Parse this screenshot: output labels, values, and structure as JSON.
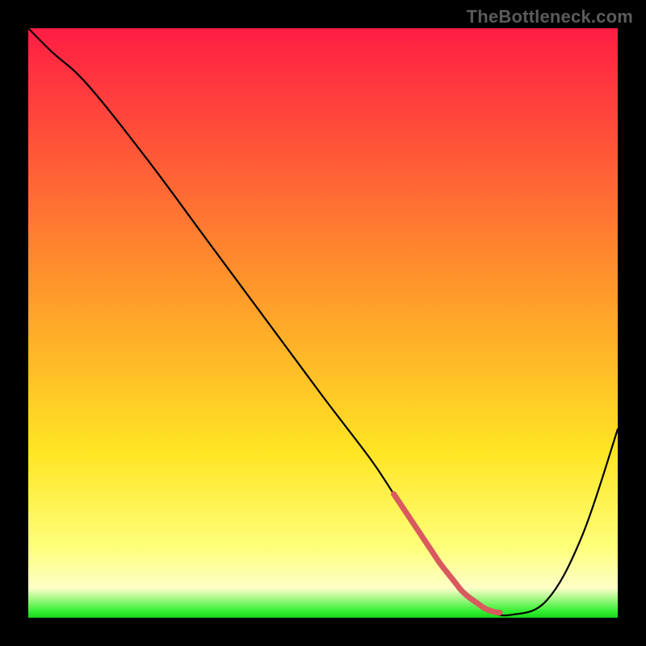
{
  "watermark": "TheBottleneck.com",
  "chart_data": {
    "type": "line",
    "title": "",
    "xlabel": "",
    "ylabel": "",
    "xlim": [
      0,
      100
    ],
    "ylim": [
      0,
      100
    ],
    "grid": false,
    "legend": false,
    "x": [
      0,
      4,
      10,
      20,
      30,
      40,
      50,
      58,
      62,
      66,
      70,
      74,
      78,
      82,
      88,
      94,
      100
    ],
    "values": [
      100,
      96,
      90.5,
      78,
      64.5,
      51,
      37.5,
      27,
      21,
      15,
      9,
      4,
      1.2,
      0.5,
      3,
      14,
      32
    ],
    "accent_segment": {
      "x_range": [
        62,
        80
      ],
      "color": "#d85a5f"
    },
    "gradient_stops": [
      {
        "pct": 0,
        "color": "#ff1d44"
      },
      {
        "pct": 45,
        "color": "#ff9a2a"
      },
      {
        "pct": 72,
        "color": "#ffe524"
      },
      {
        "pct": 88,
        "color": "#feff7a"
      },
      {
        "pct": 95,
        "color": "#fdffc8"
      },
      {
        "pct": 99,
        "color": "#2fef2f"
      },
      {
        "pct": 100,
        "color": "#1bd41b"
      }
    ]
  }
}
